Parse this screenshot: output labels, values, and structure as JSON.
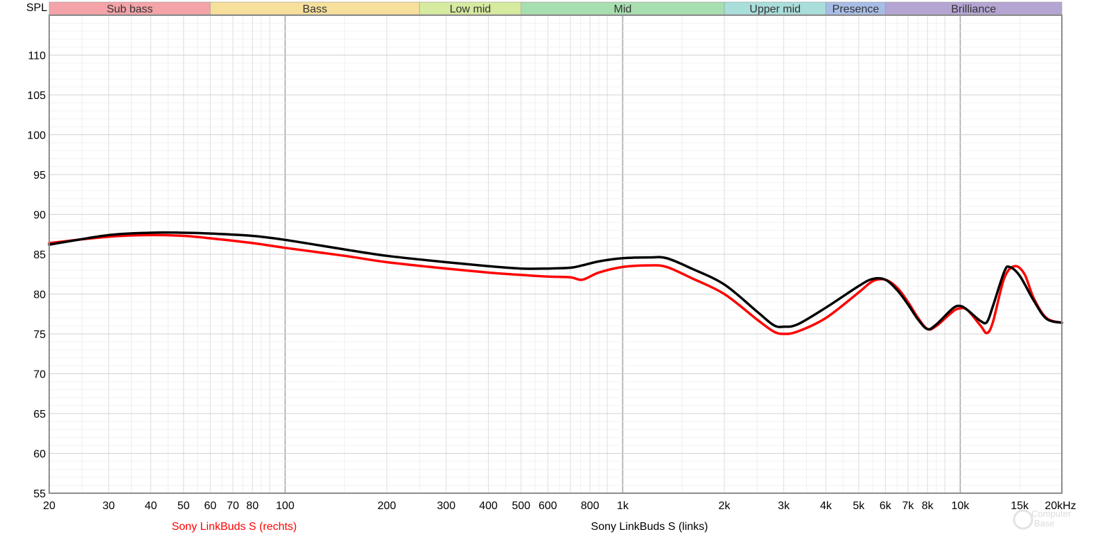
{
  "chart_data": {
    "type": "line",
    "ylabel": "SPL",
    "xlabel": "",
    "x_scale": "log",
    "xlim": [
      20,
      20000
    ],
    "ylim": [
      55,
      115
    ],
    "grid": true,
    "x_tick_values": [
      20,
      30,
      40,
      50,
      60,
      70,
      80,
      100,
      200,
      300,
      400,
      500,
      600,
      800,
      1000,
      2000,
      3000,
      4000,
      5000,
      6000,
      7000,
      8000,
      10000,
      15000,
      20000
    ],
    "x_tick_labels": [
      "20",
      "30",
      "40",
      "50",
      "60",
      "70",
      "80",
      "100",
      "200",
      "300",
      "400",
      "500",
      "600",
      "800",
      "1k",
      "2k",
      "3k",
      "4k",
      "5k",
      "6k",
      "7k",
      "8k",
      "10k",
      "15k",
      "20kHz"
    ],
    "y_ticks": [
      55,
      60,
      65,
      70,
      75,
      80,
      85,
      90,
      95,
      100,
      105,
      110
    ],
    "bands": [
      {
        "name": "Sub bass",
        "from": 20,
        "to": 60,
        "color": "#f4a3a8"
      },
      {
        "name": "Bass",
        "from": 60,
        "to": 250,
        "color": "#f7e09c"
      },
      {
        "name": "Low mid",
        "from": 250,
        "to": 500,
        "color": "#d6eaa0"
      },
      {
        "name": "Mid",
        "from": 500,
        "to": 2000,
        "color": "#a8dfb1"
      },
      {
        "name": "Upper mid",
        "from": 2000,
        "to": 4000,
        "color": "#a9dedb"
      },
      {
        "name": "Presence",
        "from": 4000,
        "to": 6000,
        "color": "#a8bde6"
      },
      {
        "name": "Brilliance",
        "from": 6000,
        "to": 20000,
        "color": "#b5a5d3"
      }
    ],
    "series": [
      {
        "name": "Sony LinkBuds S (rechts)",
        "color": "#ff0000",
        "points": [
          [
            20,
            86.4
          ],
          [
            30,
            87.2
          ],
          [
            40,
            87.4
          ],
          [
            50,
            87.3
          ],
          [
            60,
            87.0
          ],
          [
            80,
            86.4
          ],
          [
            100,
            85.8
          ],
          [
            150,
            84.8
          ],
          [
            200,
            84.0
          ],
          [
            300,
            83.2
          ],
          [
            400,
            82.7
          ],
          [
            500,
            82.4
          ],
          [
            600,
            82.2
          ],
          [
            700,
            82.1
          ],
          [
            760,
            81.8
          ],
          [
            850,
            82.7
          ],
          [
            1000,
            83.4
          ],
          [
            1200,
            83.6
          ],
          [
            1350,
            83.4
          ],
          [
            1600,
            82.0
          ],
          [
            2000,
            80.0
          ],
          [
            2500,
            76.8
          ],
          [
            2800,
            75.3
          ],
          [
            3000,
            75.0
          ],
          [
            3300,
            75.3
          ],
          [
            4000,
            77.0
          ],
          [
            5000,
            80.2
          ],
          [
            5500,
            81.6
          ],
          [
            6000,
            81.8
          ],
          [
            6500,
            80.8
          ],
          [
            7000,
            79.0
          ],
          [
            7500,
            77.0
          ],
          [
            8000,
            75.6
          ],
          [
            8500,
            76.0
          ],
          [
            9500,
            77.8
          ],
          [
            10000,
            78.2
          ],
          [
            10500,
            78.0
          ],
          [
            11500,
            76.0
          ],
          [
            12000,
            75.1
          ],
          [
            12500,
            76.5
          ],
          [
            13500,
            82.0
          ],
          [
            14500,
            83.5
          ],
          [
            15500,
            82.5
          ],
          [
            16500,
            79.5
          ],
          [
            18000,
            77.0
          ],
          [
            20000,
            76.4
          ]
        ]
      },
      {
        "name": "Sony LinkBuds S (links)",
        "color": "#000000",
        "points": [
          [
            20,
            86.2
          ],
          [
            30,
            87.4
          ],
          [
            40,
            87.7
          ],
          [
            50,
            87.7
          ],
          [
            60,
            87.6
          ],
          [
            80,
            87.3
          ],
          [
            100,
            86.8
          ],
          [
            150,
            85.6
          ],
          [
            200,
            84.8
          ],
          [
            300,
            84.0
          ],
          [
            400,
            83.5
          ],
          [
            500,
            83.2
          ],
          [
            600,
            83.2
          ],
          [
            700,
            83.3
          ],
          [
            760,
            83.6
          ],
          [
            850,
            84.1
          ],
          [
            1000,
            84.5
          ],
          [
            1200,
            84.6
          ],
          [
            1350,
            84.5
          ],
          [
            1600,
            83.2
          ],
          [
            2000,
            81.2
          ],
          [
            2500,
            77.8
          ],
          [
            2800,
            76.1
          ],
          [
            3000,
            75.9
          ],
          [
            3300,
            76.2
          ],
          [
            4000,
            78.3
          ],
          [
            5000,
            81.0
          ],
          [
            5500,
            81.9
          ],
          [
            6000,
            81.8
          ],
          [
            6500,
            80.5
          ],
          [
            7000,
            78.7
          ],
          [
            7500,
            76.8
          ],
          [
            8000,
            75.6
          ],
          [
            8500,
            76.2
          ],
          [
            9500,
            78.2
          ],
          [
            10000,
            78.5
          ],
          [
            10500,
            78.0
          ],
          [
            11500,
            76.6
          ],
          [
            12000,
            76.5
          ],
          [
            12500,
            78.5
          ],
          [
            13500,
            82.8
          ],
          [
            14000,
            83.4
          ],
          [
            15000,
            82.3
          ],
          [
            16500,
            79.2
          ],
          [
            18000,
            76.9
          ],
          [
            20000,
            76.4
          ]
        ]
      }
    ],
    "legend_placement": "bottom"
  }
}
